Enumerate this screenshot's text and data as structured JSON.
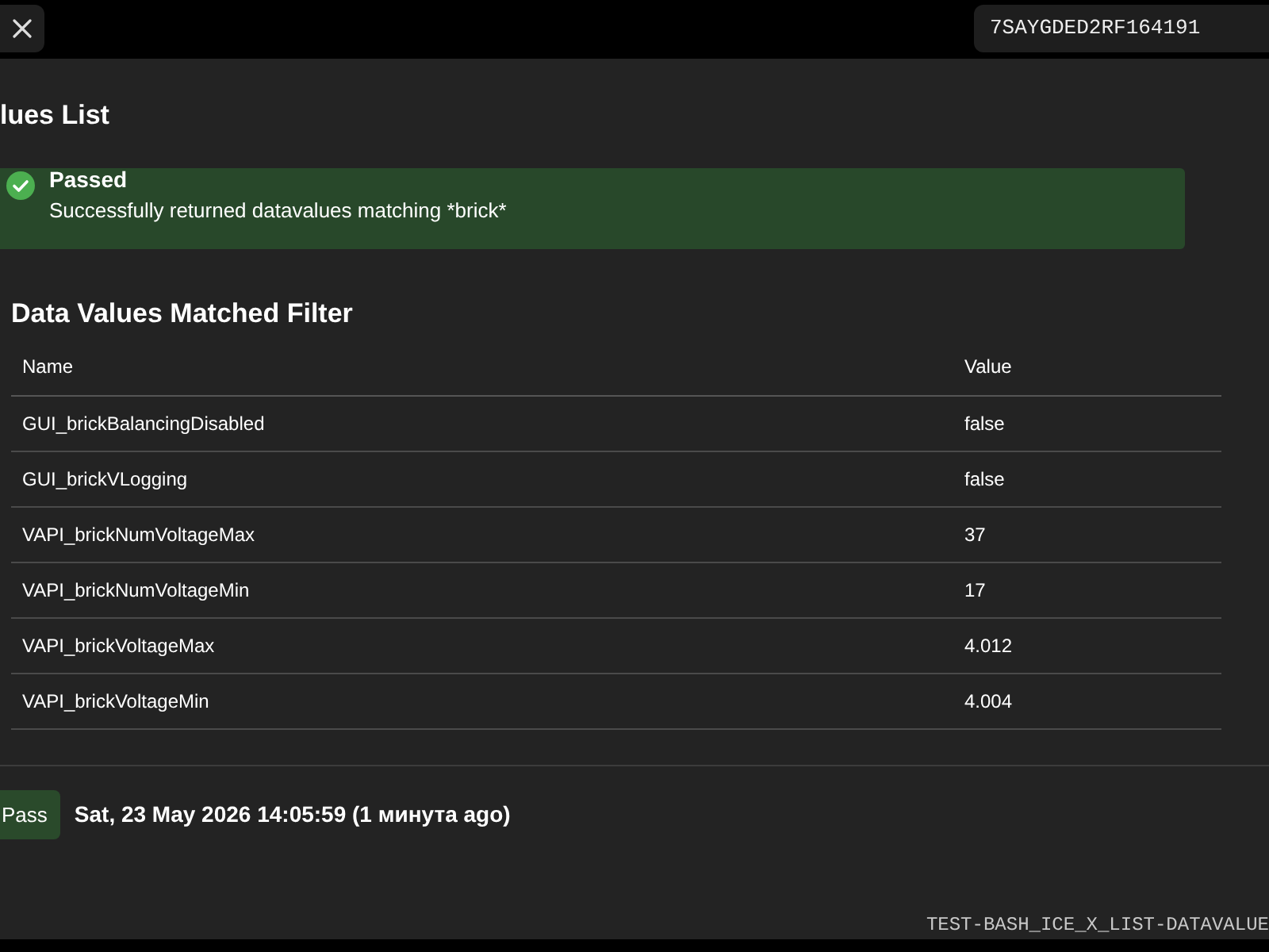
{
  "header": {
    "vin": "7SAYGDED2RF164191"
  },
  "page_title": "lues List",
  "alert": {
    "kind": "success",
    "title": "Passed",
    "message": "Successfully returned datavalues matching *brick*"
  },
  "section_title": "Data Values Matched Filter",
  "table": {
    "columns": [
      "Name",
      "Value"
    ],
    "rows": [
      [
        "GUI_brickBalancingDisabled",
        "false"
      ],
      [
        "GUI_brickVLogging",
        "false"
      ],
      [
        "VAPI_brickNumVoltageMax",
        "37"
      ],
      [
        "VAPI_brickNumVoltageMin",
        "17"
      ],
      [
        "VAPI_brickVoltageMax",
        "4.012"
      ],
      [
        "VAPI_brickVoltageMin",
        "4.004"
      ]
    ]
  },
  "result": {
    "kind": "success",
    "badge": "Pass",
    "timestamp": "Sat, 23 May 2026 14:05:59 (1 минута ago)"
  },
  "footer_code": "TEST-BASH_ICE_X_LIST-DATAVALUE"
}
